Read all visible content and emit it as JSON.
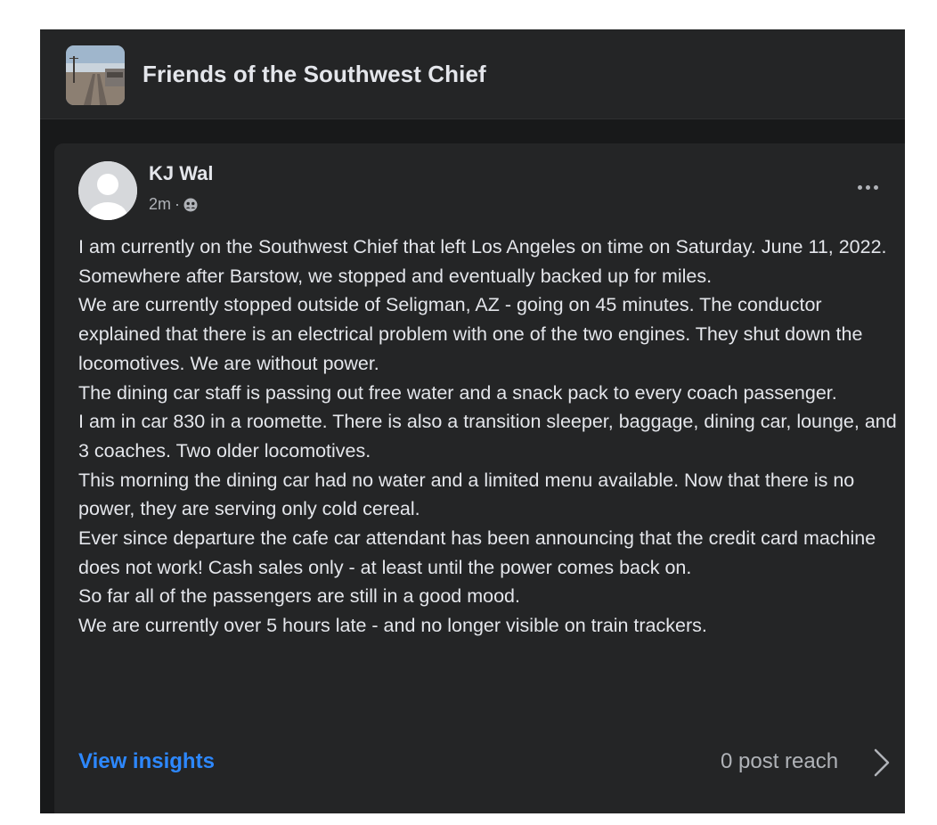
{
  "group": {
    "name": "Friends of the Southwest Chief"
  },
  "post": {
    "author": "KJ Wal",
    "time": "2m",
    "separator": "·",
    "audience_icon": "group-audience-icon",
    "more_icon": "more-options-icon",
    "body": [
      "I am currently on the Southwest Chief that left Los Angeles on time on Saturday. June 11, 2022.",
      "Somewhere after Barstow, we stopped and eventually backed up for miles.",
      "We are currently stopped outside of Seligman, AZ - going on 45 minutes.  The conductor explained that there is an electrical problem with one of the two engines.  They shut down the locomotives.  We are without power.",
      "The dining car staff is passing out free water and a snack pack to every coach passenger.",
      "I am in car 830 in a roomette.  There is also a transition sleeper, baggage, dining car, lounge, and 3 coaches.  Two older locomotives.",
      "This morning the dining car had no water and a limited menu available.  Now that there is no power, they are serving only cold cereal.",
      "Ever since departure the cafe car attendant has been announcing that the credit card machine does not work!  Cash sales only - at least until the power comes back on.",
      "So far all of the passengers are still in a good mood.",
      "We are currently over 5 hours late - and no longer visible on train trackers."
    ]
  },
  "footer": {
    "insights_label": "View insights",
    "reach_label": "0 post reach",
    "chevron_icon": "chevron-right-icon"
  },
  "colors": {
    "background": "#18191a",
    "card": "#242526",
    "text_primary": "#e4e6eb",
    "text_secondary": "#b0b3b8",
    "link": "#2d88ff"
  }
}
